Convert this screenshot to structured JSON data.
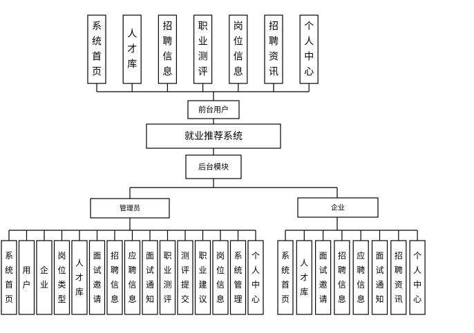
{
  "front_modules": [
    "系统首页",
    "人才库",
    "招聘信息",
    "职业测评",
    "岗位信息",
    "招聘资讯",
    "个人中心"
  ],
  "front_user": "前台用户",
  "system_name": "就业推荐系统",
  "backend": "后台模块",
  "admin": {
    "label": "管理员",
    "modules": [
      "系统首页",
      "用户",
      "企业",
      "岗位类型",
      "人才库",
      "面试邀请",
      "招聘信息",
      "应聘信息",
      "面试通知",
      "职业测评",
      "测评提交",
      "职业建议",
      "岗位信息",
      "系统管理",
      "个人中心"
    ]
  },
  "company": {
    "label": "企业",
    "modules": [
      "系统首页",
      "人才库",
      "面试邀请",
      "招聘信息",
      "应聘信息",
      "面试通知",
      "招聘资讯",
      "个人中心"
    ]
  }
}
